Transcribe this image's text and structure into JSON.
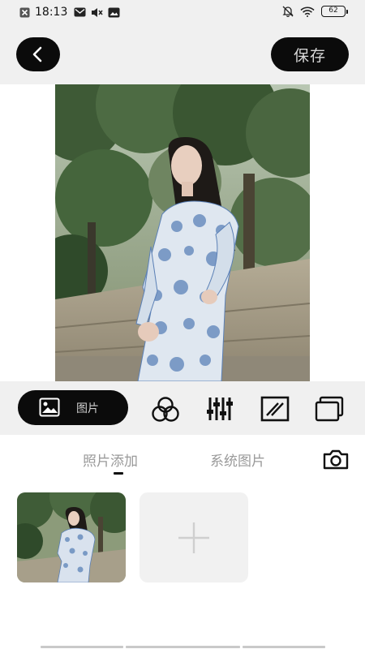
{
  "status_bar": {
    "time": "18:13",
    "battery": "62",
    "icons": [
      "close-box-icon",
      "mail-icon",
      "mute-icon",
      "image-notification-icon",
      "silent-bell-icon",
      "wifi-icon",
      "battery-icon"
    ]
  },
  "header": {
    "back_icon": "chevron-left-icon",
    "save_label": "保存"
  },
  "toolbar": {
    "photo_label": "图片",
    "tools": [
      "circles-filter-icon",
      "sliders-adjust-icon",
      "texture-square-icon",
      "layers-icon"
    ]
  },
  "panel": {
    "tabs": [
      "照片添加",
      "系统图片"
    ],
    "active_tab": 0,
    "camera_icon": "camera-icon",
    "add_icon": "plus-icon"
  },
  "colors": {
    "dark_button": "#0b0b0b",
    "background": "#f0f0f0",
    "inactive_tab": "#9a9a9a"
  }
}
